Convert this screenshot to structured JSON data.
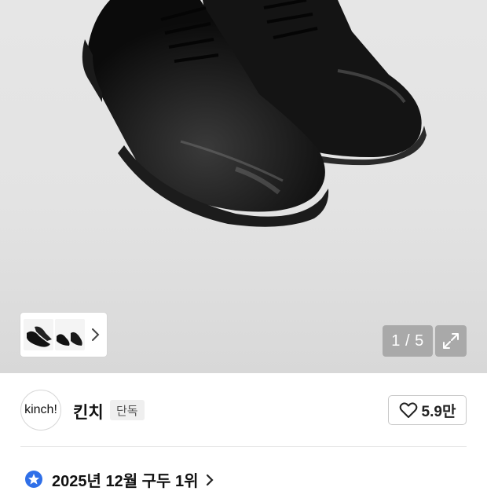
{
  "gallery": {
    "counter": "1 / 5",
    "current_index": 1,
    "total_images": 5
  },
  "thumbnails": {
    "count_visible": 2
  },
  "seller": {
    "avatar_text": "kinch!",
    "name": "킨치",
    "badge": "단독"
  },
  "like": {
    "count": "5.9만"
  },
  "ranking": {
    "text": "2025년 12월 구두 1위"
  },
  "colors": {
    "rank_icon_blue": "#2f6fe8",
    "counter_bg": "#a9a9a9"
  },
  "icons": {
    "like": "heart-outline",
    "expand": "expand-diagonal-arrows",
    "thumbs_more": "chevron-right",
    "rank": "blue-star-badge",
    "rank_more": "chevron-right"
  }
}
